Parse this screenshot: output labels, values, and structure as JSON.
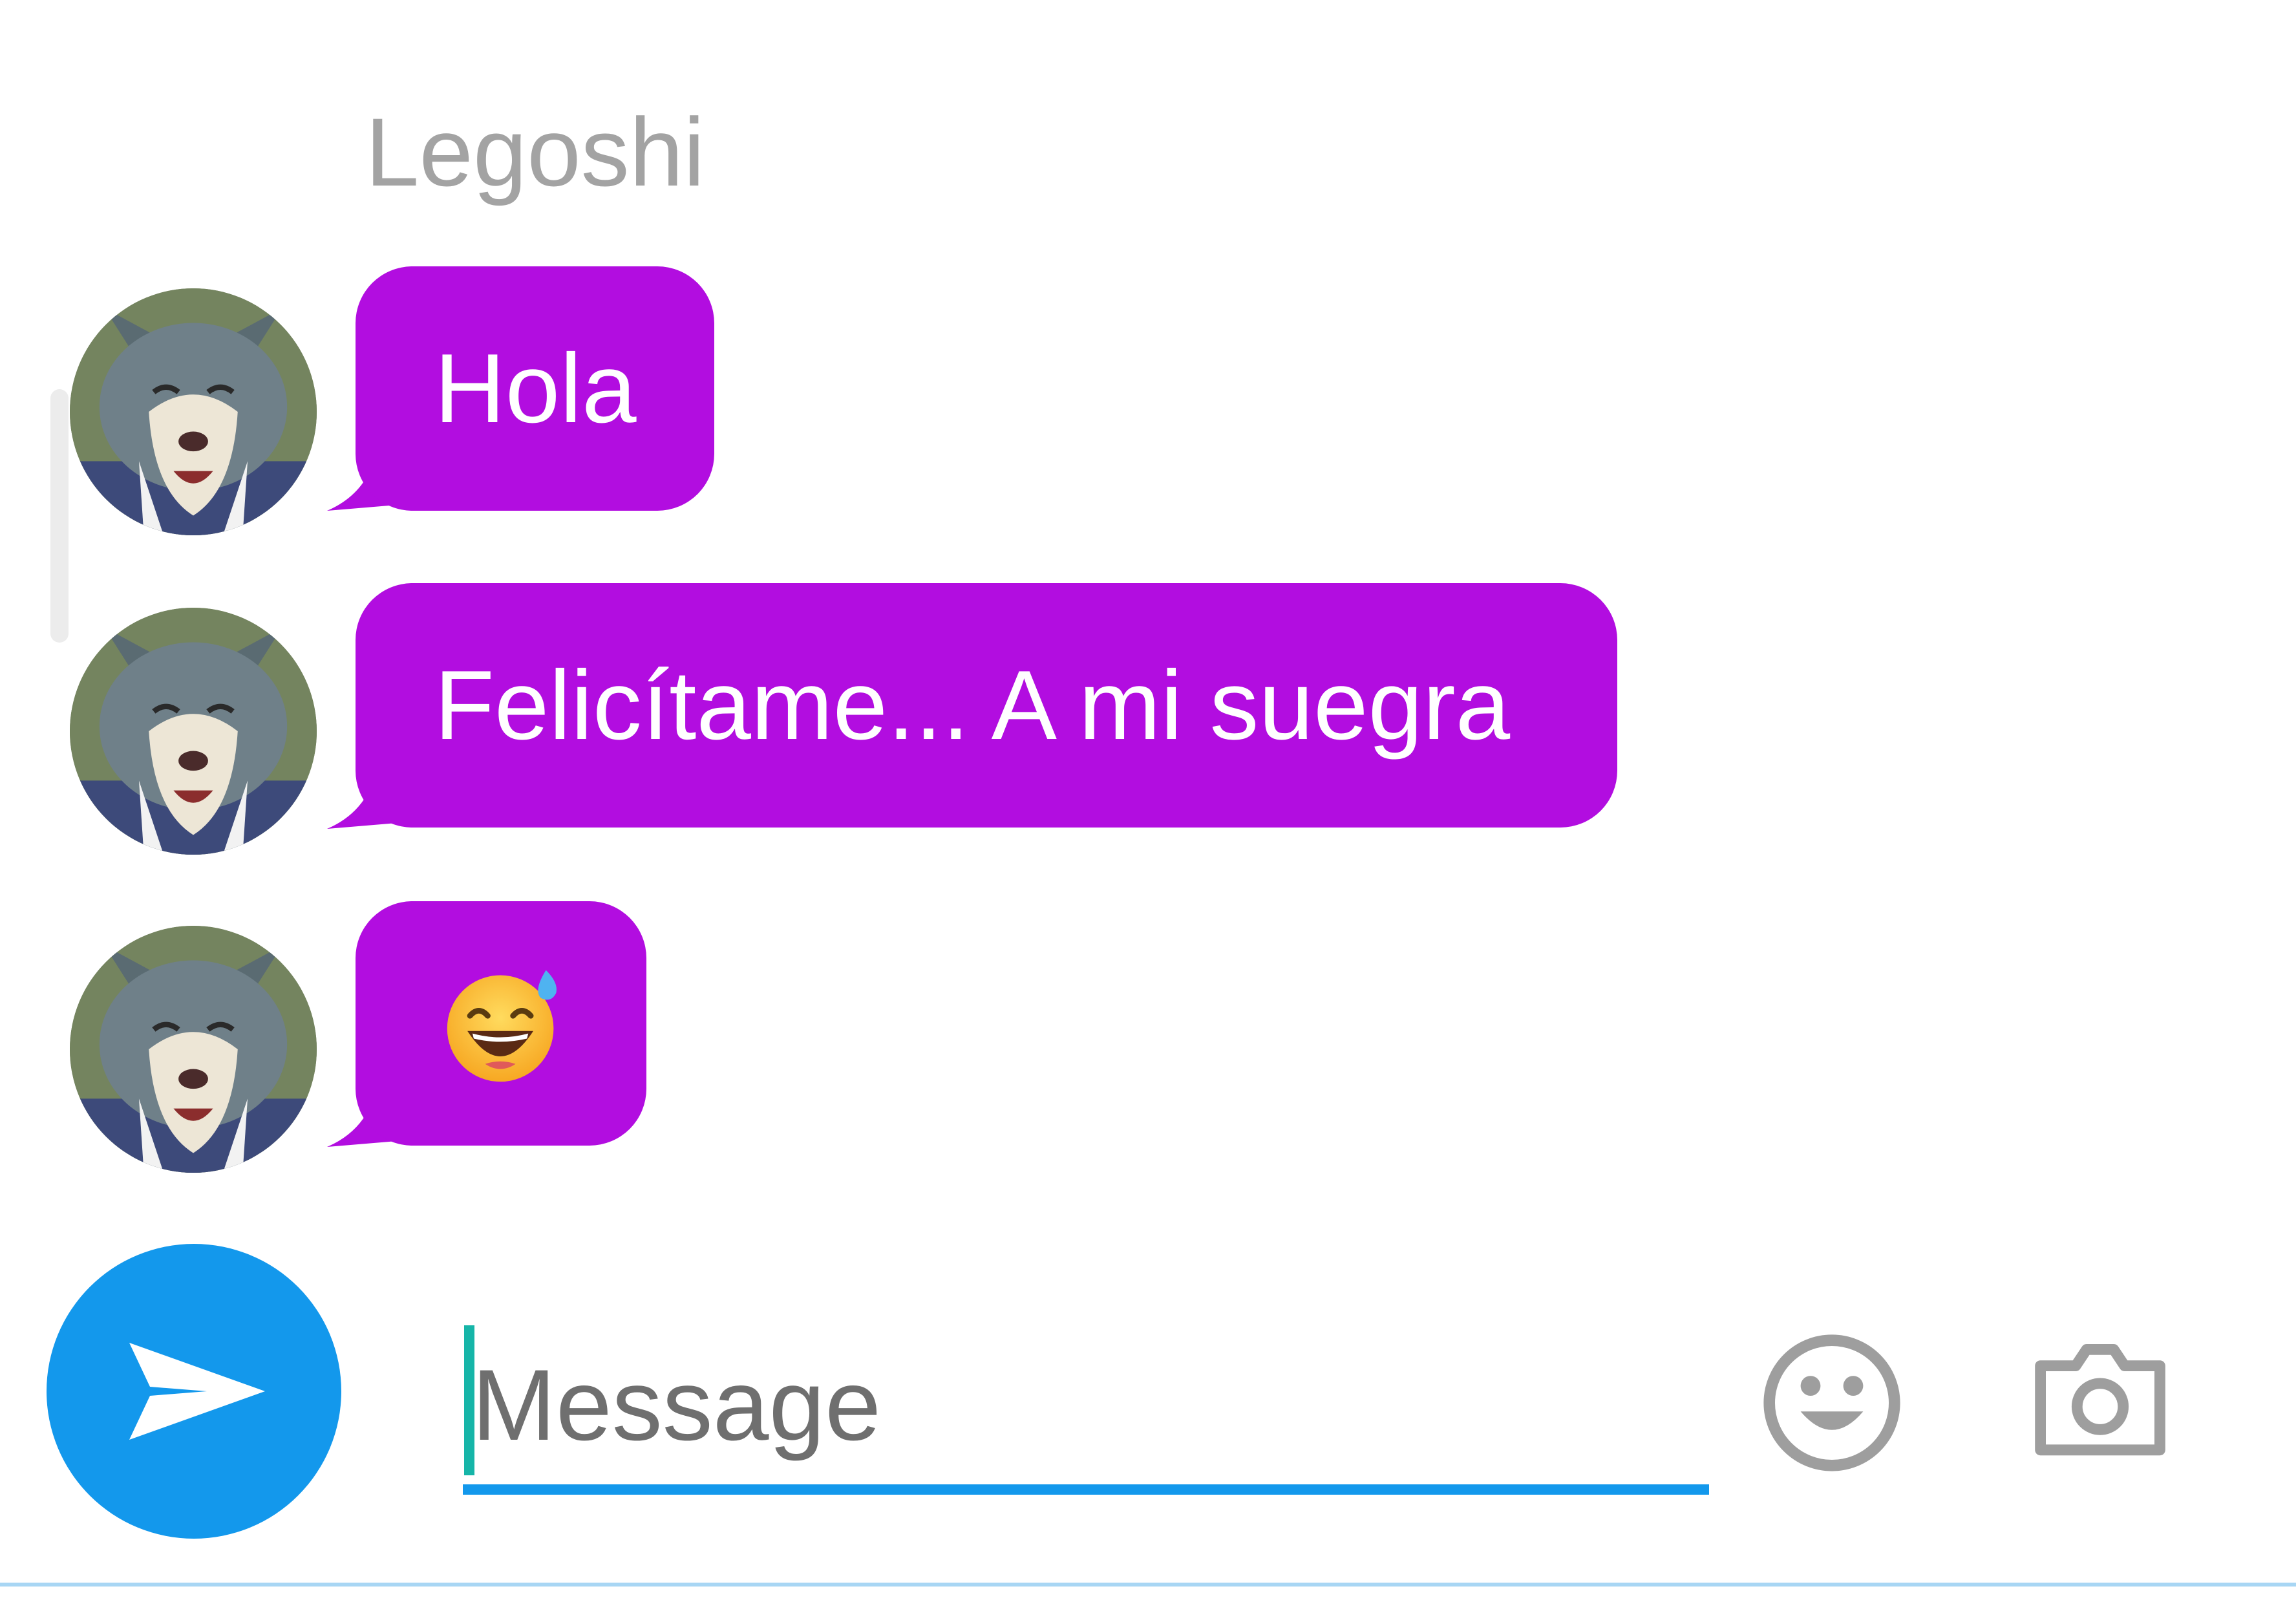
{
  "conversation": {
    "sender_name": "Legoshi",
    "messages": [
      {
        "text": "Hola",
        "type": "text"
      },
      {
        "text": "Felicítame... A mi suegra",
        "type": "text"
      },
      {
        "text": "😅",
        "type": "emoji",
        "icon": "grinning-face-with-sweat-icon"
      }
    ]
  },
  "composer": {
    "placeholder": "Message",
    "value": "",
    "send_icon": "send-icon",
    "emoji_icon": "smiley-icon",
    "camera_icon": "camera-icon"
  },
  "colors": {
    "bubble": "#b20de0",
    "bubble_text": "#ffffff",
    "send_button": "#1398ec",
    "input_underline": "#1398ec",
    "caret": "#16b5a8",
    "sender_name": "#a3a3a3",
    "icon_gray": "#9e9e9e"
  }
}
